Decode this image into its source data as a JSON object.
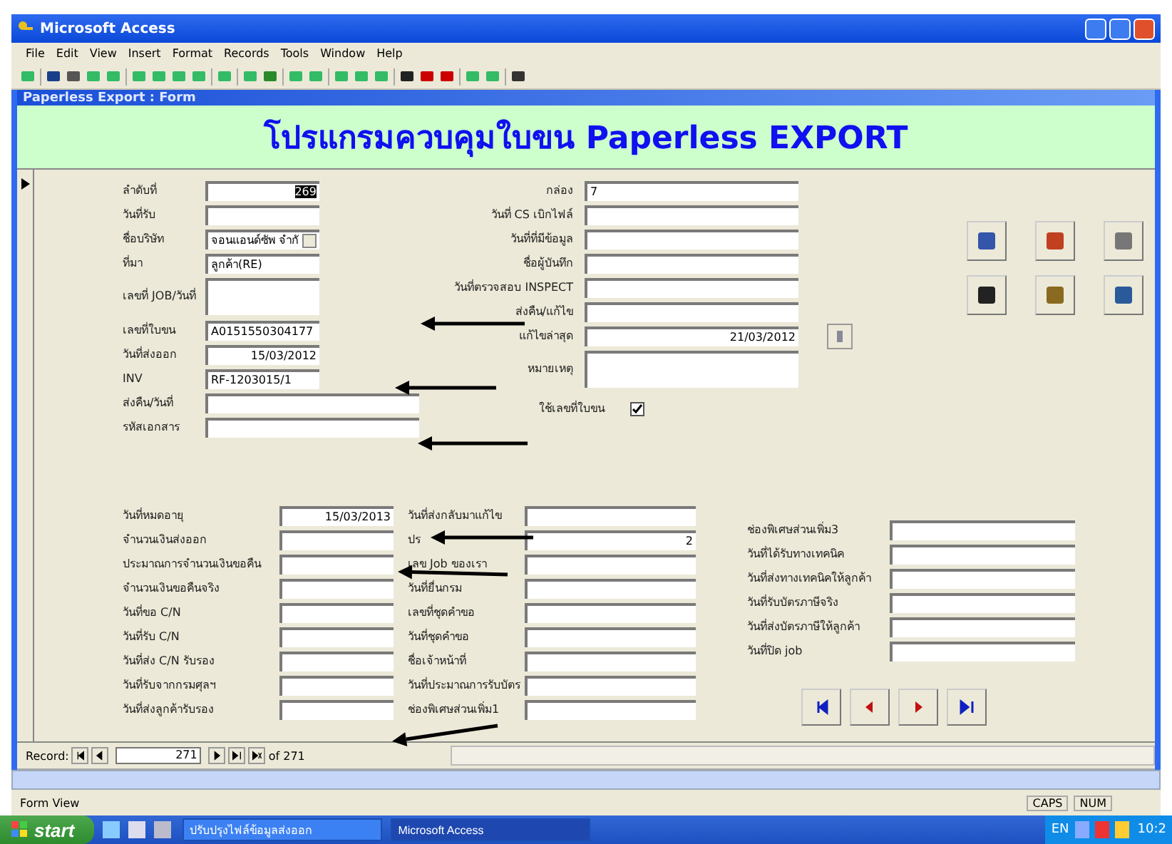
{
  "window": {
    "title": "Microsoft Access"
  },
  "menu": [
    "File",
    "Edit",
    "View",
    "Insert",
    "Format",
    "Records",
    "Tools",
    "Window",
    "Help"
  ],
  "form": {
    "title": "Paperless Export : Form",
    "heading": "โปรแกรมควบคุมใบขน Paperless EXPORT"
  },
  "top_left": [
    {
      "label": "ลำดับที่",
      "value": "269",
      "kind": "number",
      "highlighted": true
    },
    {
      "label": "วันที่รับ"
    },
    {
      "label": "ชื่อบริษัท",
      "value": "จอนแอนด์ซัพ จำกั",
      "kind": "combo"
    },
    {
      "label": "ที่มา",
      "value": "ลูกค้า(RE)",
      "kind": "text"
    },
    {
      "label": "เลขที่ JOB/วันที่",
      "kind": "memo"
    },
    {
      "label": "เลขที่ใบขน",
      "value": "A0151550304177",
      "kind": "text"
    },
    {
      "label": "วันที่ส่งออก",
      "value": "15/03/2012",
      "kind": "number"
    },
    {
      "label": "INV",
      "value": "RF-1203015/1",
      "kind": "text"
    },
    {
      "label": "ส่งคืน/วันที่",
      "kind": "wide"
    },
    {
      "label": "รหัสเอกสาร",
      "kind": "wide"
    }
  ],
  "top_middle": [
    {
      "label": "กล่อง",
      "value": "7",
      "kind": "text"
    },
    {
      "label": "วันที่ CS เบิกไฟล์"
    },
    {
      "label": "วันที่ที่มีข้อมูล"
    },
    {
      "label": "ชื่อผู้บันทึก"
    },
    {
      "label": "วันที่ตรวจสอบ INSPECT"
    },
    {
      "label": "ส่งคืน/แก้ไข"
    },
    {
      "label": "แก้ไขล่าสุด",
      "value": "21/03/2012",
      "kind": "number"
    },
    {
      "label": "หมายเหตุ",
      "kind": "memo"
    }
  ],
  "checkbox": {
    "label": "ใช้เลขที่ใบขน",
    "checked": true
  },
  "bottom_left": [
    {
      "label": "วันที่หมดอายุ",
      "value": "15/03/2013",
      "kind": "number"
    },
    {
      "label": "จำนวนเงินส่งออก"
    },
    {
      "label": "ประมาณการจำนวนเงินขอคืน"
    },
    {
      "label": "จำนวนเงินขอคืนจริง"
    },
    {
      "label": "วันที่ขอ C/N"
    },
    {
      "label": "วันที่รับ C/N"
    },
    {
      "label": "วันที่ส่ง C/N รับรอง"
    },
    {
      "label": "วันที่รับจากกรมศุลฯ"
    },
    {
      "label": "วันที่ส่งลูกค้ารับรอง"
    }
  ],
  "bottom_middle": [
    {
      "label": "วันที่ส่งกลับมาแก้ไข"
    },
    {
      "label": "ปร",
      "value": "2",
      "kind": "number"
    },
    {
      "label": "เลข Job ของเรา"
    },
    {
      "label": "วันที่ยื่นกรม"
    },
    {
      "label": "เลขที่ชุดคำขอ"
    },
    {
      "label": "วันที่ชุดคำขอ"
    },
    {
      "label": "ชื่อเจ้าหน้าที่"
    },
    {
      "label": "วันที่ประมาณการรับบัตร"
    },
    {
      "label": "ช่องพิเศษส่วนเพิ่ม1"
    }
  ],
  "bottom_right": [
    {
      "label": "ช่องพิเศษส่วนเพิ่ม3"
    },
    {
      "label": "วันที่ได้รับทางเทคนิค"
    },
    {
      "label": "วันที่ส่งทางเทคนิคให้ลูกค้า"
    },
    {
      "label": "วันที่รับบัตรภาษีจริง"
    },
    {
      "label": "วันที่ส่งบัตรภาษีให้ลูกค้า"
    },
    {
      "label": "วันที่ปิด job"
    }
  ],
  "record_nav": {
    "label": "Record:",
    "current": "271",
    "total": "of 271"
  },
  "status_bar": {
    "text": "Form View",
    "indicators": [
      "CAPS",
      "NUM"
    ]
  },
  "taskbar": {
    "start": "start",
    "tasks": [
      {
        "label": "ปรับปรุงไฟล์ข้อมูลส่งออก",
        "selected": false
      },
      {
        "label": "Microsoft Access",
        "selected": true
      }
    ],
    "language": "EN",
    "clock": "10:2"
  }
}
